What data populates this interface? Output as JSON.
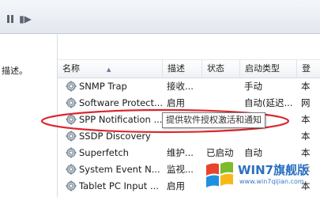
{
  "left_pane": {
    "description_label": "描述。"
  },
  "columns": [
    {
      "label": "名称"
    },
    {
      "label": "描述"
    },
    {
      "label": "状态"
    },
    {
      "label": "启动类型"
    },
    {
      "label": "登"
    }
  ],
  "services": [
    {
      "name": "SNMP Trap",
      "description": "接收...",
      "status": "",
      "startup": "手动",
      "logon": "本"
    },
    {
      "name": "Software Protect...",
      "description": "启用",
      "status": "",
      "startup": "自动(延迟...",
      "logon": "网"
    },
    {
      "name": "SPP Notification ...",
      "description": "",
      "status": "",
      "startup": "",
      "logon": "本"
    },
    {
      "name": "SSDP Discovery",
      "description": "",
      "status": "",
      "startup": "",
      "logon": "本"
    },
    {
      "name": "Superfetch",
      "description": "维护...",
      "status": "已启动",
      "startup": "自动",
      "logon": "本"
    },
    {
      "name": "System Event N...",
      "description": "监视...",
      "status": "",
      "startup": "",
      "logon": "本"
    },
    {
      "name": "Tablet PC Input ...",
      "description": "启用",
      "status": "",
      "startup": "",
      "logon": "本"
    }
  ],
  "tooltip": {
    "text": "提供软件授权激活和通知"
  },
  "watermark": {
    "title": "WIN7旗舰版",
    "url": "www.win7qijian.com"
  },
  "colors": {
    "highlight_ellipse": "#d9282f",
    "watermark_blue": "#2b6fc0"
  },
  "icons": {
    "toolbar_pause": "pause-icon",
    "toolbar_restart": "restart-icon",
    "service": "gear-icon"
  }
}
